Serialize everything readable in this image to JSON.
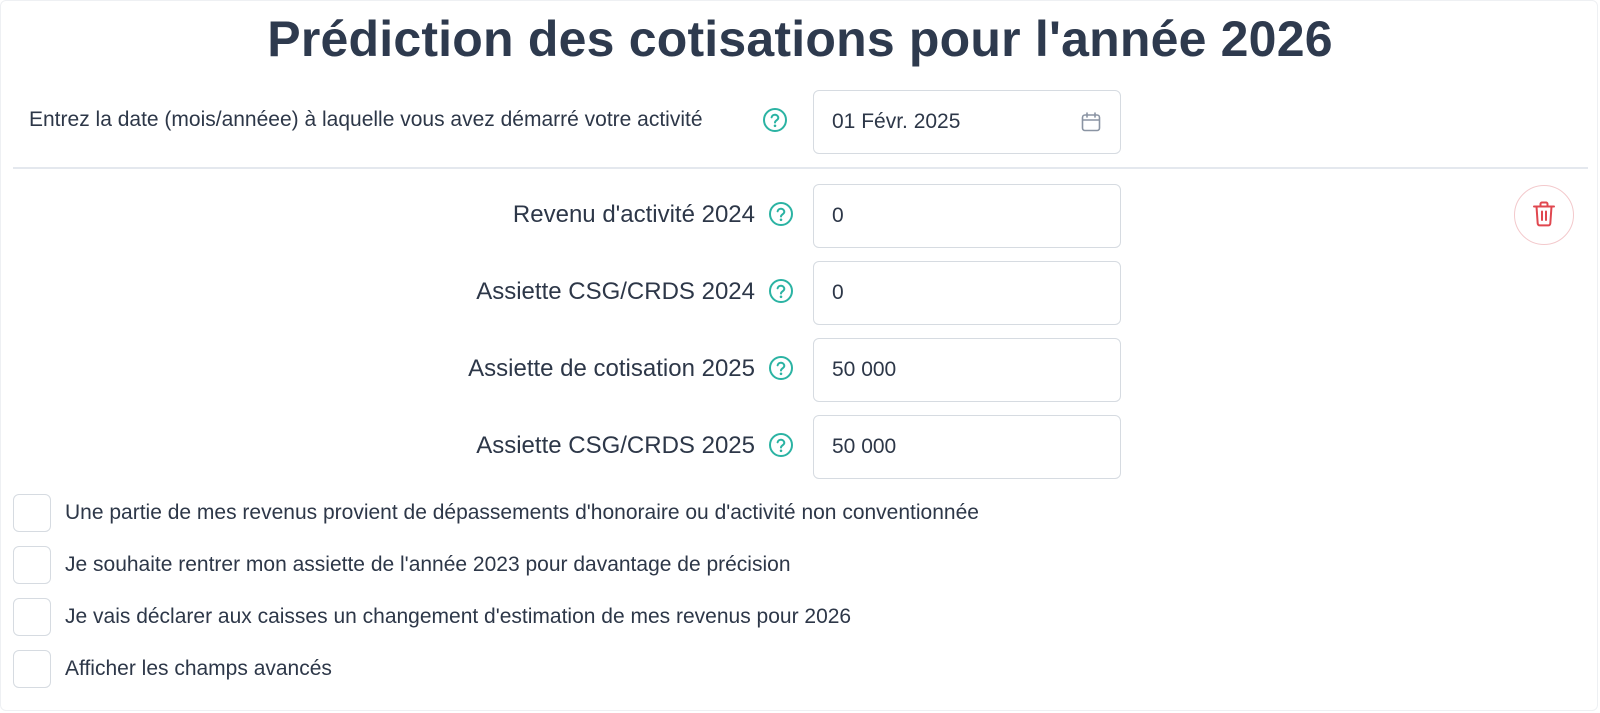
{
  "title": "Prédiction des cotisations pour l'année 2026",
  "start_date": {
    "label": "Entrez la date (mois/annéee) à laquelle vous avez démarré votre activité",
    "value": "01 Févr. 2025"
  },
  "fields": [
    {
      "label": "Revenu d'activité 2024",
      "value": "0"
    },
    {
      "label": "Assiette CSG/CRDS 2024",
      "value": "0"
    },
    {
      "label": "Assiette de cotisation 2025",
      "value": "50 000"
    },
    {
      "label": "Assiette CSG/CRDS 2025",
      "value": "50 000"
    }
  ],
  "checkboxes": [
    {
      "label": "Une partie de mes revenus provient de dépassements d'honoraire ou d'activité non conventionnée",
      "checked": false
    },
    {
      "label": "Je souhaite rentrer mon assiette de l'année 2023 pour davantage de précision",
      "checked": false
    },
    {
      "label": "Je vais déclarer aux caisses un changement d'estimation de mes revenus pour 2026",
      "checked": false
    },
    {
      "label": "Afficher les champs avancés",
      "checked": false
    }
  ],
  "icons": {
    "help": "help-circle-icon",
    "calendar": "calendar-icon",
    "delete": "trash-icon"
  },
  "colors": {
    "accent": "#2bb3a3",
    "danger": "#e0474f",
    "text": "#2d3748",
    "title": "#2e3a4e",
    "border": "#d6dbe1"
  }
}
